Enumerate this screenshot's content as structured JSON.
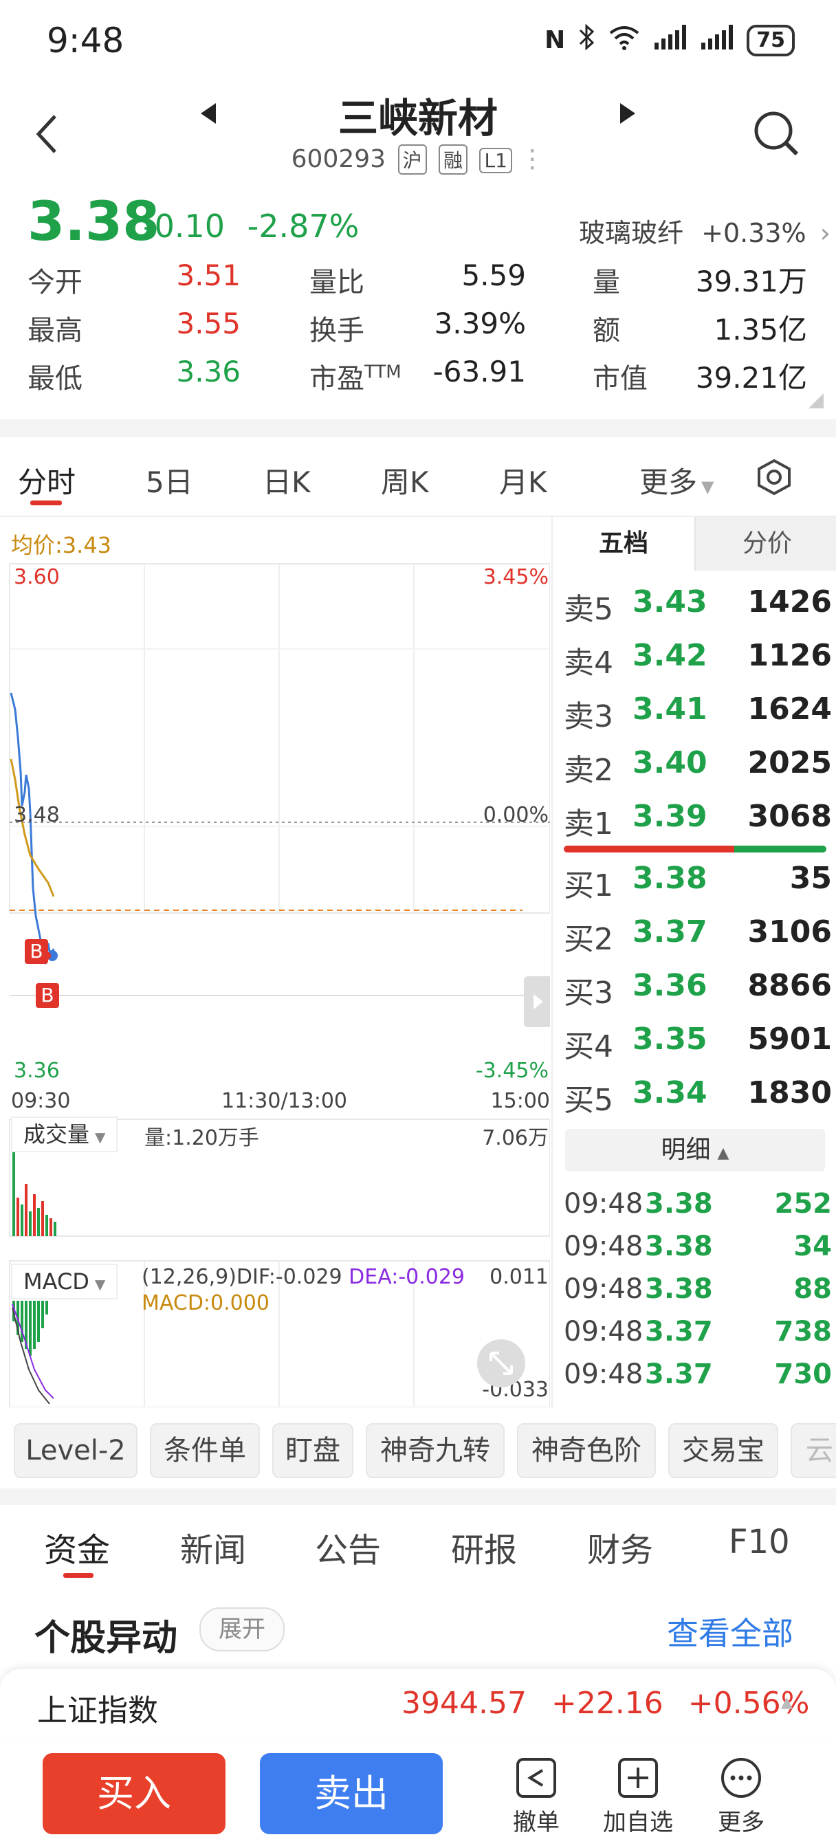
{
  "status_bar": {
    "time": "9:48",
    "battery": "75",
    "signal_label": "6"
  },
  "header": {
    "title": "三峡新材",
    "code": "600293",
    "tags": [
      "沪",
      "融",
      "L1"
    ]
  },
  "quote": {
    "price": "3.38",
    "change": "-0.10",
    "change_pct": "-2.87%",
    "sector_name": "玻璃玻纤",
    "sector_pct": "+0.33%",
    "metrics": [
      [
        {
          "label": "今开",
          "value": "3.51",
          "color": "red"
        },
        {
          "label": "量比",
          "value": "5.59",
          "color": "dark"
        },
        {
          "label": "量",
          "value": "39.31万",
          "color": "dark"
        }
      ],
      [
        {
          "label": "最高",
          "value": "3.55",
          "color": "red"
        },
        {
          "label": "换手",
          "value": "3.39%",
          "color": "dark"
        },
        {
          "label": "额",
          "value": "1.35亿",
          "color": "dark"
        }
      ],
      [
        {
          "label": "最低",
          "value": "3.36",
          "color": "green"
        },
        {
          "label": "市盈",
          "label_sup": "TTM",
          "value": "-63.91",
          "color": "dark"
        },
        {
          "label": "市值",
          "value": "39.21亿",
          "color": "dark"
        }
      ]
    ]
  },
  "chart_tabs": [
    "分时",
    "5日",
    "日K",
    "周K",
    "月K",
    "更多"
  ],
  "chart": {
    "avg_label": "均价:3.43",
    "top_price": "3.60",
    "top_pct": "3.45%",
    "mid_price": "3.48",
    "mid_pct": "0.00%",
    "bot_price": "3.36",
    "bot_pct": "-3.45%",
    "time_start": "09:30",
    "time_mid": "11:30/13:00",
    "time_end": "15:00",
    "vol_selector": "成交量",
    "vol_label": "量:1.20万手",
    "vol_max": "7.06万",
    "macd_selector": "MACD",
    "macd_params": "(12,26,9)DIF:-0.029",
    "macd_dea": "DEA:-0.029",
    "macd_val": "MACD:0.000",
    "macd_top": "0.011",
    "macd_bot": "-0.033",
    "markers": [
      "B",
      "B"
    ]
  },
  "orderbook": {
    "tabs": [
      "五档",
      "分价"
    ],
    "asks": [
      {
        "label": "卖5",
        "price": "3.43",
        "vol": "1426"
      },
      {
        "label": "卖4",
        "price": "3.42",
        "vol": "1126"
      },
      {
        "label": "卖3",
        "price": "3.41",
        "vol": "1624"
      },
      {
        "label": "卖2",
        "price": "3.40",
        "vol": "2025"
      },
      {
        "label": "卖1",
        "price": "3.39",
        "vol": "3068"
      }
    ],
    "bids": [
      {
        "label": "买1",
        "price": "3.38",
        "vol": "35"
      },
      {
        "label": "买2",
        "price": "3.37",
        "vol": "3106"
      },
      {
        "label": "买3",
        "price": "3.36",
        "vol": "8866"
      },
      {
        "label": "买4",
        "price": "3.35",
        "vol": "5901"
      },
      {
        "label": "买5",
        "price": "3.34",
        "vol": "1830"
      }
    ],
    "detail_label": "明细",
    "ticks": [
      {
        "time": "09:48",
        "price": "3.38",
        "vol": "252"
      },
      {
        "time": "09:48",
        "price": "3.38",
        "vol": "34"
      },
      {
        "time": "09:48",
        "price": "3.38",
        "vol": "88"
      },
      {
        "time": "09:48",
        "price": "3.37",
        "vol": "738"
      },
      {
        "time": "09:48",
        "price": "3.37",
        "vol": "730"
      }
    ]
  },
  "tools": [
    "Level-2",
    "条件单",
    "盯盘",
    "神奇九转",
    "神奇色阶",
    "交易宝",
    "云"
  ],
  "bottom_tabs": [
    "资金",
    "新闻",
    "公告",
    "研报",
    "财务",
    "F10"
  ],
  "anomaly": {
    "title": "个股异动",
    "expand": "展开",
    "view_all": "查看全部"
  },
  "index": {
    "name": "上证指数",
    "value": "3944.57",
    "change": "+22.16",
    "pct": "+0.56%"
  },
  "actions": {
    "buy": "买入",
    "sell": "卖出",
    "cancel": "撤单",
    "watch": "加自选",
    "more": "更多"
  }
}
